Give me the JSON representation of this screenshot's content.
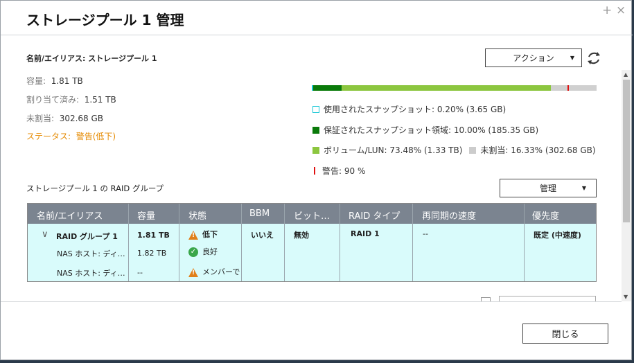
{
  "window": {
    "title": "ストレージプール 1 管理"
  },
  "titlebar_buttons": {
    "plus": "+",
    "close": "×"
  },
  "pool": {
    "name_line": "名前/エイリアス: ストレージプール 1",
    "capacity_label": "容量:",
    "capacity_value": "1.81 TB",
    "allocated_label": "割り当て済み:",
    "allocated_value": "1.51 TB",
    "unallocated_label": "未割当:",
    "unallocated_value": "302.68 GB",
    "status_label": "ステータス:",
    "status_value": "警告(低下)"
  },
  "action_button": {
    "label": "アクション"
  },
  "usage": {
    "snapshot_pct": 0.2,
    "reserved_pct": 10.0,
    "volume_pct": 73.48,
    "unallocated_pct": 16.33,
    "warning_pct": 90,
    "colors": {
      "snapshot": "#19c7d6",
      "reserved": "#0a7a0a",
      "volume": "#8cc63f",
      "unallocated": "#cccccc",
      "warning": "#e01010"
    },
    "legend": {
      "snapshot": "使用されたスナップショット: 0.20% (3.65 GB)",
      "reserved": "保証されたスナップショット領域: 10.00% (185.35 GB)",
      "volume": "ボリューム/LUN: 73.48% (1.33 TB)",
      "unallocated": "未割当: 16.33% (302.68 GB)",
      "warning": "警告: 90 %"
    }
  },
  "raid_section": {
    "title": "ストレージプール 1 の RAID グループ",
    "manage_label": "管理"
  },
  "table": {
    "headers": [
      "名前/エイリアス",
      "容量",
      "状態",
      "BBM",
      "ビット…",
      "RAID タイプ",
      "再同期の速度",
      "優先度"
    ],
    "group": {
      "name": "RAID グループ 1",
      "capacity": "1.81 TB",
      "status": "低下",
      "bbm": "いいえ",
      "bitmap": "無効",
      "raid_type": "RAID 1",
      "resync": "--",
      "priority": "既定 (中速度)"
    },
    "disks": [
      {
        "name": "NAS ホスト: ディ…",
        "capacity": "1.82 TB",
        "status": "良好"
      },
      {
        "name": "NAS ホスト: ディ…",
        "capacity": "--",
        "status": "メンバーで"
      }
    ]
  },
  "footer": {
    "close_label": "閉じる"
  }
}
